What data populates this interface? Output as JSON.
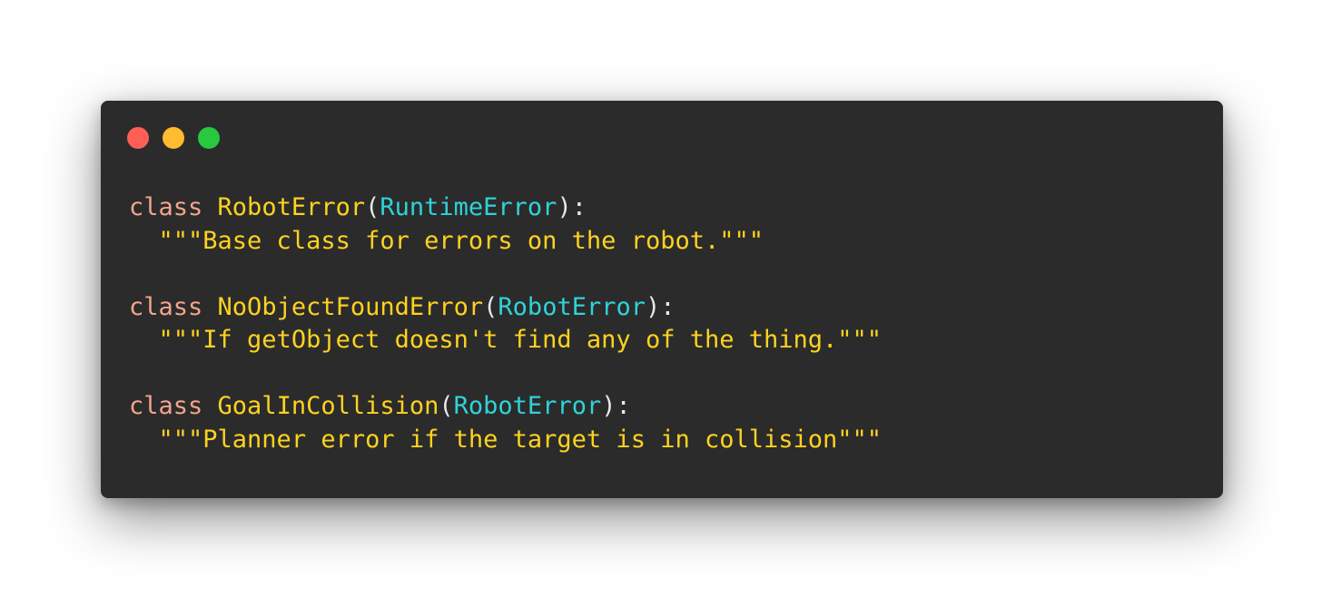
{
  "colors": {
    "background": "#ffffff",
    "window": "#2b2b2b",
    "dot_close": "#ff5f57",
    "dot_minimize": "#febc2e",
    "dot_maximize": "#28c840",
    "keyword": "#f3a58c",
    "class_name": "#ffd21f",
    "base_class": "#2fd3d8",
    "punctuation": "#e8e8e8",
    "string": "#ffd21f"
  },
  "code": {
    "lines": [
      {
        "kind": "code",
        "tokens": [
          {
            "role": "keyword",
            "text": "class"
          },
          {
            "role": "punctuation",
            "text": " "
          },
          {
            "role": "class_name",
            "text": "RobotError"
          },
          {
            "role": "punctuation",
            "text": "("
          },
          {
            "role": "base_class",
            "text": "RuntimeError"
          },
          {
            "role": "punctuation",
            "text": "):"
          }
        ]
      },
      {
        "kind": "code",
        "tokens": [
          {
            "role": "punctuation",
            "text": "  "
          },
          {
            "role": "string",
            "text": "\"\"\"Base class for errors on the robot.\"\"\""
          }
        ]
      },
      {
        "kind": "blank",
        "tokens": []
      },
      {
        "kind": "code",
        "tokens": [
          {
            "role": "keyword",
            "text": "class"
          },
          {
            "role": "punctuation",
            "text": " "
          },
          {
            "role": "class_name",
            "text": "NoObjectFoundError"
          },
          {
            "role": "punctuation",
            "text": "("
          },
          {
            "role": "base_class",
            "text": "RobotError"
          },
          {
            "role": "punctuation",
            "text": "):"
          }
        ]
      },
      {
        "kind": "code",
        "tokens": [
          {
            "role": "punctuation",
            "text": "  "
          },
          {
            "role": "string",
            "text": "\"\"\"If getObject doesn't find any of the thing.\"\"\""
          }
        ]
      },
      {
        "kind": "blank",
        "tokens": []
      },
      {
        "kind": "code",
        "tokens": [
          {
            "role": "keyword",
            "text": "class"
          },
          {
            "role": "punctuation",
            "text": " "
          },
          {
            "role": "class_name",
            "text": "GoalInCollision"
          },
          {
            "role": "punctuation",
            "text": "("
          },
          {
            "role": "base_class",
            "text": "RobotError"
          },
          {
            "role": "punctuation",
            "text": "):"
          }
        ]
      },
      {
        "kind": "code",
        "tokens": [
          {
            "role": "punctuation",
            "text": "  "
          },
          {
            "role": "string",
            "text": "\"\"\"Planner error if the target is in collision\"\"\""
          }
        ]
      }
    ]
  }
}
